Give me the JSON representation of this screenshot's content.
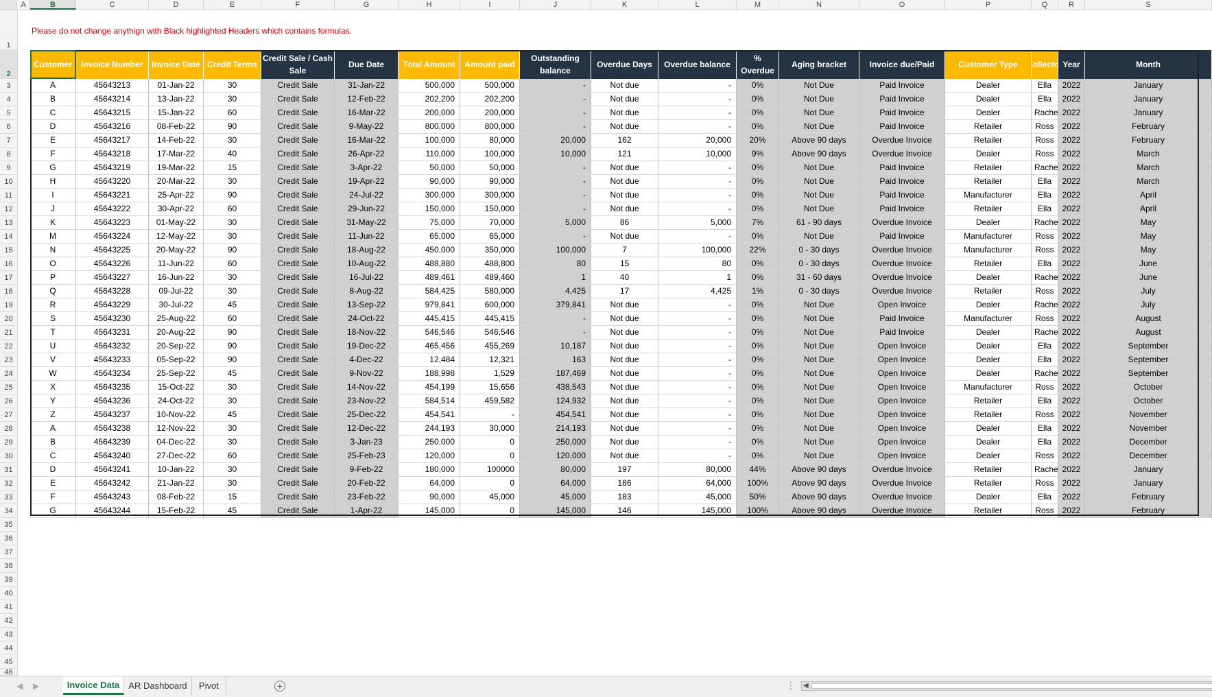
{
  "sheet": {
    "column_letters": [
      "A",
      "B",
      "C",
      "D",
      "E",
      "F",
      "G",
      "H",
      "I",
      "J",
      "K",
      "L",
      "M",
      "N",
      "O",
      "P",
      "Q",
      "R",
      "S"
    ],
    "note": "Please do not change anythign with Black highlighted Headers which contains formulas.",
    "headers": [
      {
        "label": "Customer",
        "style": "yellow"
      },
      {
        "label": "Invoice Number",
        "style": "yellow"
      },
      {
        "label": "Invoice Date",
        "style": "yellow"
      },
      {
        "label": "Credit Terms",
        "style": "yellow"
      },
      {
        "label": "Credit Sale / Cash Sale",
        "style": "dark"
      },
      {
        "label": "Due Date",
        "style": "dark"
      },
      {
        "label": "Total Amount",
        "style": "yellow"
      },
      {
        "label": "Amount paid",
        "style": "yellow"
      },
      {
        "label": "Outstanding balance",
        "style": "dark"
      },
      {
        "label": "Overdue Days",
        "style": "dark"
      },
      {
        "label": "Overdue balance",
        "style": "dark"
      },
      {
        "label": "% Overdue",
        "style": "dark"
      },
      {
        "label": "Aging bracket",
        "style": "dark"
      },
      {
        "label": "Invoice due/Paid",
        "style": "dark"
      },
      {
        "label": "Customer Type",
        "style": "yellow"
      },
      {
        "label": "Collector",
        "style": "yellow"
      },
      {
        "label": "Year",
        "style": "dark"
      },
      {
        "label": "Month",
        "style": "dark"
      }
    ],
    "rows": [
      [
        "A",
        "45643213",
        "01-Jan-22",
        "30",
        "Credit Sale",
        "31-Jan-22",
        "500,000",
        "500,000",
        "-",
        "Not due",
        "-",
        "0%",
        "Not Due",
        "Paid Invoice",
        "Dealer",
        "Ella",
        "2022",
        "January"
      ],
      [
        "B",
        "45643214",
        "13-Jan-22",
        "30",
        "Credit Sale",
        "12-Feb-22",
        "202,200",
        "202,200",
        "-",
        "Not due",
        "-",
        "0%",
        "Not Due",
        "Paid Invoice",
        "Dealer",
        "Ella",
        "2022",
        "January"
      ],
      [
        "C",
        "45643215",
        "15-Jan-22",
        "60",
        "Credit Sale",
        "16-Mar-22",
        "200,000",
        "200,000",
        "-",
        "Not due",
        "-",
        "0%",
        "Not Due",
        "Paid Invoice",
        "Dealer",
        "Racheal",
        "2022",
        "January"
      ],
      [
        "D",
        "45643216",
        "08-Feb-22",
        "90",
        "Credit Sale",
        "9-May-22",
        "800,000",
        "800,000",
        "-",
        "Not due",
        "-",
        "0%",
        "Not Due",
        "Paid Invoice",
        "Retailer",
        "Ross",
        "2022",
        "February"
      ],
      [
        "E",
        "45643217",
        "14-Feb-22",
        "30",
        "Credit Sale",
        "16-Mar-22",
        "100,000",
        "80,000",
        "20,000",
        "162",
        "20,000",
        "20%",
        "Above 90 days",
        "Overdue Invoice",
        "Retailer",
        "Ross",
        "2022",
        "February"
      ],
      [
        "F",
        "45643218",
        "17-Mar-22",
        "40",
        "Credit Sale",
        "26-Apr-22",
        "110,000",
        "100,000",
        "10,000",
        "121",
        "10,000",
        "9%",
        "Above 90 days",
        "Overdue Invoice",
        "Dealer",
        "Ross",
        "2022",
        "March"
      ],
      [
        "G",
        "45643219",
        "19-Mar-22",
        "15",
        "Credit Sale",
        "3-Apr-22",
        "50,000",
        "50,000",
        "-",
        "Not due",
        "-",
        "0%",
        "Not Due",
        "Paid Invoice",
        "Retailer",
        "Racheal",
        "2022",
        "March"
      ],
      [
        "H",
        "45643220",
        "20-Mar-22",
        "30",
        "Credit Sale",
        "19-Apr-22",
        "90,000",
        "90,000",
        "-",
        "Not due",
        "-",
        "0%",
        "Not Due",
        "Paid Invoice",
        "Retailer",
        "Ella",
        "2022",
        "March"
      ],
      [
        "I",
        "45643221",
        "25-Apr-22",
        "90",
        "Credit Sale",
        "24-Jul-22",
        "300,000",
        "300,000",
        "-",
        "Not due",
        "-",
        "0%",
        "Not Due",
        "Paid Invoice",
        "Manufacturer",
        "Ella",
        "2022",
        "April"
      ],
      [
        "J",
        "45643222",
        "30-Apr-22",
        "60",
        "Credit Sale",
        "29-Jun-22",
        "150,000",
        "150,000",
        "-",
        "Not due",
        "-",
        "0%",
        "Not Due",
        "Paid Invoice",
        "Retailer",
        "Ella",
        "2022",
        "April"
      ],
      [
        "K",
        "45643223",
        "01-May-22",
        "30",
        "Credit Sale",
        "31-May-22",
        "75,000",
        "70,000",
        "5,000",
        "86",
        "5,000",
        "7%",
        "61 - 90 days",
        "Overdue Invoice",
        "Dealer",
        "Racheal",
        "2022",
        "May"
      ],
      [
        "M",
        "45643224",
        "12-May-22",
        "30",
        "Credit Sale",
        "11-Jun-22",
        "65,000",
        "65,000",
        "-",
        "Not due",
        "-",
        "0%",
        "Not Due",
        "Paid Invoice",
        "Manufacturer",
        "Ross",
        "2022",
        "May"
      ],
      [
        "N",
        "45643225",
        "20-May-22",
        "90",
        "Credit Sale",
        "18-Aug-22",
        "450,000",
        "350,000",
        "100,000",
        "7",
        "100,000",
        "22%",
        "0 - 30 days",
        "Overdue Invoice",
        "Manufacturer",
        "Ross",
        "2022",
        "May"
      ],
      [
        "O",
        "45643226",
        "11-Jun-22",
        "60",
        "Credit Sale",
        "10-Aug-22",
        "488,880",
        "488,800",
        "80",
        "15",
        "80",
        "0%",
        "0 - 30 days",
        "Overdue Invoice",
        "Retailer",
        "Ella",
        "2022",
        "June"
      ],
      [
        "P",
        "45643227",
        "16-Jun-22",
        "30",
        "Credit Sale",
        "16-Jul-22",
        "489,461",
        "489,460",
        "1",
        "40",
        "1",
        "0%",
        "31 - 60 days",
        "Overdue Invoice",
        "Dealer",
        "Racheal",
        "2022",
        "June"
      ],
      [
        "Q",
        "45643228",
        "09-Jul-22",
        "30",
        "Credit Sale",
        "8-Aug-22",
        "584,425",
        "580,000",
        "4,425",
        "17",
        "4,425",
        "1%",
        "0 - 30 days",
        "Overdue Invoice",
        "Retailer",
        "Ross",
        "2022",
        "July"
      ],
      [
        "R",
        "45643229",
        "30-Jul-22",
        "45",
        "Credit Sale",
        "13-Sep-22",
        "979,841",
        "600,000",
        "379,841",
        "Not due",
        "-",
        "0%",
        "Not Due",
        "Open Invoice",
        "Dealer",
        "Racheal",
        "2022",
        "July"
      ],
      [
        "S",
        "45643230",
        "25-Aug-22",
        "60",
        "Credit Sale",
        "24-Oct-22",
        "445,415",
        "445,415",
        "-",
        "Not due",
        "-",
        "0%",
        "Not Due",
        "Paid Invoice",
        "Manufacturer",
        "Ross",
        "2022",
        "August"
      ],
      [
        "T",
        "45643231",
        "20-Aug-22",
        "90",
        "Credit Sale",
        "18-Nov-22",
        "546,546",
        "546,546",
        "-",
        "Not due",
        "-",
        "0%",
        "Not Due",
        "Paid Invoice",
        "Dealer",
        "Racheal",
        "2022",
        "August"
      ],
      [
        "U",
        "45643232",
        "20-Sep-22",
        "90",
        "Credit Sale",
        "19-Dec-22",
        "465,456",
        "455,269",
        "10,187",
        "Not due",
        "-",
        "0%",
        "Not Due",
        "Open Invoice",
        "Dealer",
        "Ella",
        "2022",
        "September"
      ],
      [
        "V",
        "45643233",
        "05-Sep-22",
        "90",
        "Credit Sale",
        "4-Dec-22",
        "12,484",
        "12,321",
        "163",
        "Not due",
        "-",
        "0%",
        "Not Due",
        "Open Invoice",
        "Dealer",
        "Ella",
        "2022",
        "September"
      ],
      [
        "W",
        "45643234",
        "25-Sep-22",
        "45",
        "Credit Sale",
        "9-Nov-22",
        "188,998",
        "1,529",
        "187,469",
        "Not due",
        "-",
        "0%",
        "Not Due",
        "Open Invoice",
        "Dealer",
        "Racheal",
        "2022",
        "September"
      ],
      [
        "X",
        "45643235",
        "15-Oct-22",
        "30",
        "Credit Sale",
        "14-Nov-22",
        "454,199",
        "15,656",
        "438,543",
        "Not due",
        "-",
        "0%",
        "Not Due",
        "Open Invoice",
        "Manufacturer",
        "Ross",
        "2022",
        "October"
      ],
      [
        "Y",
        "45643236",
        "24-Oct-22",
        "30",
        "Credit Sale",
        "23-Nov-22",
        "584,514",
        "459,582",
        "124,932",
        "Not due",
        "-",
        "0%",
        "Not Due",
        "Open Invoice",
        "Retailer",
        "Ella",
        "2022",
        "October"
      ],
      [
        "Z",
        "45643237",
        "10-Nov-22",
        "45",
        "Credit Sale",
        "25-Dec-22",
        "454,541",
        "-",
        "454,541",
        "Not due",
        "-",
        "0%",
        "Not Due",
        "Open Invoice",
        "Retailer",
        "Ross",
        "2022",
        "November"
      ],
      [
        "A",
        "45643238",
        "12-Nov-22",
        "30",
        "Credit Sale",
        "12-Dec-22",
        "244,193",
        "30,000",
        "214,193",
        "Not due",
        "-",
        "0%",
        "Not Due",
        "Open Invoice",
        "Dealer",
        "Ella",
        "2022",
        "November"
      ],
      [
        "B",
        "45643239",
        "04-Dec-22",
        "30",
        "Credit Sale",
        "3-Jan-23",
        "250,000",
        "0",
        "250,000",
        "Not due",
        "-",
        "0%",
        "Not Due",
        "Open Invoice",
        "Dealer",
        "Ella",
        "2022",
        "December"
      ],
      [
        "C",
        "45643240",
        "27-Dec-22",
        "60",
        "Credit Sale",
        "25-Feb-23",
        "120,000",
        "0",
        "120,000",
        "Not due",
        "-",
        "0%",
        "Not Due",
        "Open Invoice",
        "Dealer",
        "Ross",
        "2022",
        "December"
      ],
      [
        "D",
        "45643241",
        "10-Jan-22",
        "30",
        "Credit Sale",
        "9-Feb-22",
        "180,000",
        "100000",
        "80,000",
        "197",
        "80,000",
        "44%",
        "Above 90 days",
        "Overdue Invoice",
        "Retailer",
        "Racheal",
        "2022",
        "January"
      ],
      [
        "E",
        "45643242",
        "21-Jan-22",
        "30",
        "Credit Sale",
        "20-Feb-22",
        "64,000",
        "0",
        "64,000",
        "186",
        "64,000",
        "100%",
        "Above 90 days",
        "Overdue Invoice",
        "Retailer",
        "Ross",
        "2022",
        "January"
      ],
      [
        "F",
        "45643243",
        "08-Feb-22",
        "15",
        "Credit Sale",
        "23-Feb-22",
        "90,000",
        "45,000",
        "45,000",
        "183",
        "45,000",
        "50%",
        "Above 90 days",
        "Overdue Invoice",
        "Dealer",
        "Ella",
        "2022",
        "February"
      ],
      [
        "G",
        "45643244",
        "15-Feb-22",
        "45",
        "Credit Sale",
        "1-Apr-22",
        "145,000",
        "0",
        "145,000",
        "146",
        "145,000",
        "100%",
        "Above 90 days",
        "Overdue Invoice",
        "Retailer",
        "Ross",
        "2022",
        "February"
      ]
    ]
  },
  "tabs": [
    {
      "label": "Invoice Data",
      "active": true
    },
    {
      "label": "AR Dashboard",
      "active": false
    },
    {
      "label": "Pivot",
      "active": false
    }
  ],
  "add_sheet_label": "+",
  "nav": {
    "prev": "◀",
    "next": "▶",
    "dots": "⋮",
    "scroll_left": "◀"
  },
  "colors": {
    "yellow_header": "#ffb900",
    "dark_header": "#253445",
    "gray_fill": "#d0d0d0",
    "note_red": "#e00000",
    "excel_green": "#217346"
  }
}
